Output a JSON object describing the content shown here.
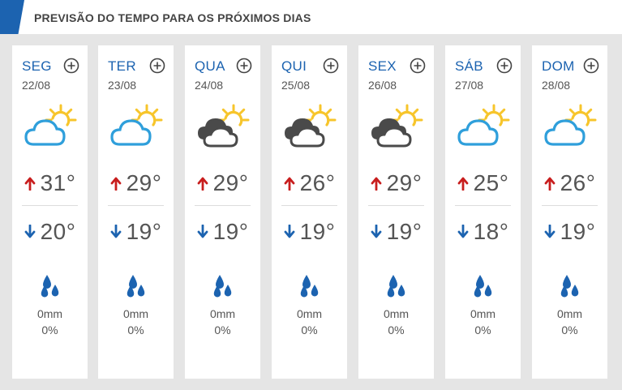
{
  "header": {
    "title": "PREVISÃO DO TEMPO PARA OS PRÓXIMOS DIAS"
  },
  "colors": {
    "accent": "#1c63b0",
    "high_arrow": "#c81e1e",
    "low_arrow": "#1c63b0",
    "sun": "#f7c52b",
    "cloud_light": "#2f9fdb",
    "cloud_dark": "#4a4a4a",
    "drop": "#1c63b0"
  },
  "days": [
    {
      "name": "SEG",
      "date": "22/08",
      "icon": "sun-cloud-light-icon",
      "high": "31°",
      "low": "20°",
      "rain_mm": "0mm",
      "rain_pct": "0%"
    },
    {
      "name": "TER",
      "date": "23/08",
      "icon": "sun-cloud-light-icon",
      "high": "29°",
      "low": "19°",
      "rain_mm": "0mm",
      "rain_pct": "0%"
    },
    {
      "name": "QUA",
      "date": "24/08",
      "icon": "sun-cloud-dark-icon",
      "high": "29°",
      "low": "19°",
      "rain_mm": "0mm",
      "rain_pct": "0%"
    },
    {
      "name": "QUI",
      "date": "25/08",
      "icon": "sun-cloud-dark-icon",
      "high": "26°",
      "low": "19°",
      "rain_mm": "0mm",
      "rain_pct": "0%"
    },
    {
      "name": "SEX",
      "date": "26/08",
      "icon": "sun-cloud-dark-icon",
      "high": "29°",
      "low": "19°",
      "rain_mm": "0mm",
      "rain_pct": "0%"
    },
    {
      "name": "SÁB",
      "date": "27/08",
      "icon": "sun-cloud-light-icon",
      "high": "25°",
      "low": "18°",
      "rain_mm": "0mm",
      "rain_pct": "0%"
    },
    {
      "name": "DOM",
      "date": "28/08",
      "icon": "sun-cloud-light-icon",
      "high": "26°",
      "low": "19°",
      "rain_mm": "0mm",
      "rain_pct": "0%"
    }
  ]
}
